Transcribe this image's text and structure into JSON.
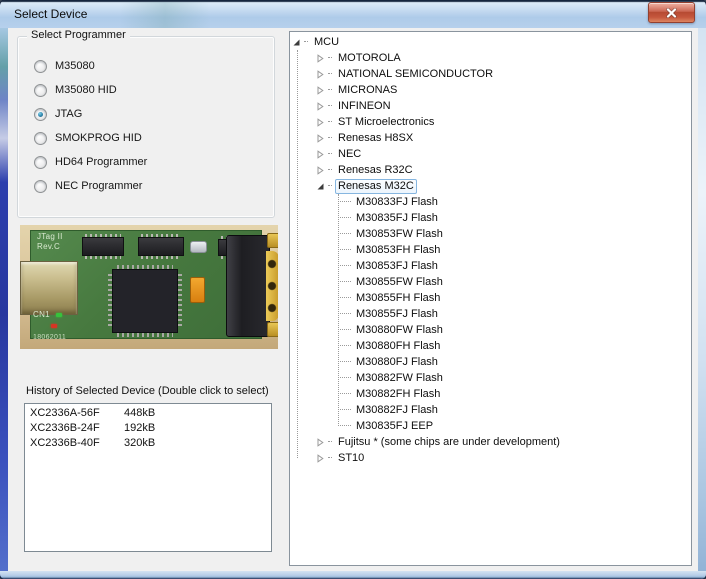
{
  "window": {
    "title": "Select Device"
  },
  "colors": {
    "close_button_red": "#c0492f",
    "tree_selection_border": "#86b6e0",
    "pcb_green": "#47793f",
    "radio_selected_dot": "#2f86ad",
    "dialog_background": "#f0f0f0"
  },
  "programmer": {
    "group_label": "Select Programmer",
    "options": [
      {
        "label": "M35080",
        "selected": false
      },
      {
        "label": "M35080 HID",
        "selected": false
      },
      {
        "label": "JTAG",
        "selected": true
      },
      {
        "label": "SMOKPROG HID",
        "selected": false
      },
      {
        "label": "HD64 Programmer",
        "selected": false
      },
      {
        "label": "NEC Programmer",
        "selected": false
      }
    ]
  },
  "photo": {
    "silkscreen_line1": "JTag II",
    "silkscreen_line2": "Rev.C",
    "connector_label": "CN1",
    "date_code": "18062011"
  },
  "history": {
    "label": "History of Selected Device (Double click to select)",
    "items": [
      {
        "name": "XC2336A-56F",
        "size": "448kB"
      },
      {
        "name": "XC2336B-24F",
        "size": "192kB"
      },
      {
        "name": "XC2336B-40F",
        "size": "320kB"
      }
    ]
  },
  "tree": {
    "rows": [
      {
        "level": 0,
        "label": "MCU",
        "state": "expanded"
      },
      {
        "level": 1,
        "label": "MOTOROLA",
        "state": "collapsed"
      },
      {
        "level": 1,
        "label": "NATIONAL SEMICONDUCTOR",
        "state": "collapsed"
      },
      {
        "level": 1,
        "label": "MICRONAS",
        "state": "collapsed"
      },
      {
        "level": 1,
        "label": "INFINEON",
        "state": "collapsed"
      },
      {
        "level": 1,
        "label": "ST Microelectronics",
        "state": "collapsed"
      },
      {
        "level": 1,
        "label": "Renesas H8SX",
        "state": "collapsed"
      },
      {
        "level": 1,
        "label": "NEC",
        "state": "collapsed"
      },
      {
        "level": 1,
        "label": "Renesas R32C",
        "state": "collapsed"
      },
      {
        "level": 1,
        "label": "Renesas M32C",
        "state": "expanded",
        "selected": true
      },
      {
        "level": 2,
        "label": "M30833FJ Flash"
      },
      {
        "level": 2,
        "label": "M30835FJ Flash"
      },
      {
        "level": 2,
        "label": "M30853FW Flash"
      },
      {
        "level": 2,
        "label": "M30853FH Flash"
      },
      {
        "level": 2,
        "label": "M30853FJ Flash"
      },
      {
        "level": 2,
        "label": "M30855FW Flash"
      },
      {
        "level": 2,
        "label": "M30855FH Flash"
      },
      {
        "level": 2,
        "label": "M30855FJ Flash"
      },
      {
        "level": 2,
        "label": "M30880FW Flash"
      },
      {
        "level": 2,
        "label": "M30880FH Flash"
      },
      {
        "level": 2,
        "label": "M30880FJ Flash"
      },
      {
        "level": 2,
        "label": "M30882FW Flash"
      },
      {
        "level": 2,
        "label": "M30882FH Flash"
      },
      {
        "level": 2,
        "label": "M30882FJ Flash"
      },
      {
        "level": 2,
        "label": "M30835FJ EEP"
      },
      {
        "level": 1,
        "label": "Fujitsu * (some chips are under development)",
        "state": "collapsed"
      },
      {
        "level": 1,
        "label": "ST10",
        "state": "collapsed"
      }
    ]
  }
}
